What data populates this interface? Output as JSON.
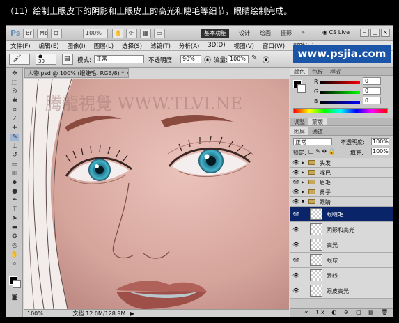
{
  "caption": "（11）绘制上眼皮下的阴影和上眼皮上的高光和睫毛等细节，眼睛绘制完成。",
  "appbar": {
    "logo": "Ps",
    "zoom_value": "100%",
    "workspaces": [
      "基本功能",
      "设计",
      "绘画",
      "摄影",
      "»"
    ],
    "cs_live": "CS Live"
  },
  "menu": [
    "文件(F)",
    "编辑(E)",
    "图像(I)",
    "图层(L)",
    "选择(S)",
    "滤镜(T)",
    "分析(A)",
    "3D(D)",
    "视图(V)",
    "窗口(W)",
    "帮助(H)"
  ],
  "options": {
    "brush_size": "30",
    "mode_label": "模式:",
    "mode_value": "正常",
    "opacity_label": "不透明度:",
    "opacity_value": "90%",
    "flow_label": "流量:",
    "flow_value": "100%"
  },
  "site_watermark": "www.psjia.com",
  "canvas_watermark": "腾龍視覺 WWW.TLVI.NE",
  "doc_tab": "人物.psd @ 100% (眼睫毛, RGB/8) *",
  "status": {
    "zoom": "100%",
    "doc_info": "文档:12.0M/128.9M"
  },
  "color_panel": {
    "tabs": [
      "颜色",
      "色板",
      "样式"
    ],
    "channels": [
      {
        "label": "R",
        "value": "0"
      },
      {
        "label": "G",
        "value": "0"
      },
      {
        "label": "B",
        "value": "0"
      }
    ]
  },
  "adjust_panel": {
    "tabs": [
      "调整",
      "蒙版"
    ]
  },
  "layers_panel": {
    "tabs": [
      "图层",
      "通道"
    ],
    "blend_mode": "正常",
    "opacity_label": "不透明度:",
    "opacity_value": "100%",
    "lock_label": "锁定:",
    "fill_label": "填充:",
    "fill_value": "100%",
    "folders": [
      "头发",
      "嘴巴",
      "眉毛",
      "鼻子",
      "眼睛"
    ],
    "layers": [
      "眼睫毛",
      "阴影和高光",
      "高光",
      "眼球",
      "眼线",
      "眼皮高光"
    ],
    "selected_layer": "眼睫毛"
  },
  "colors": {
    "skin": "#d8aba3",
    "selection": "#0a246a",
    "iris": "#3a9fb5"
  }
}
